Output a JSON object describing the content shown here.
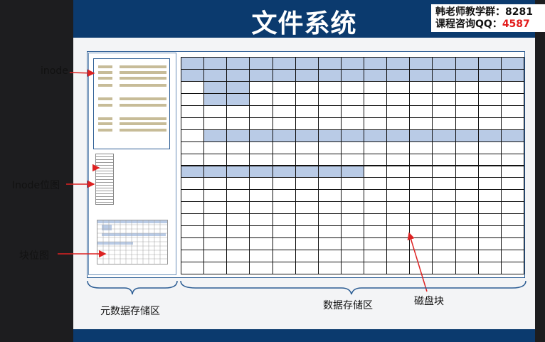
{
  "title": "文件系统",
  "corner": {
    "group_label": "韩老师教学群：",
    "group_value": "8281",
    "qq_label": "课程咨询QQ：",
    "qq_value": "4587"
  },
  "labels": {
    "inode": "inode",
    "inode_bitmap": "Inode位图",
    "block_bitmap": "块位图",
    "metadata_area": "元数据存储区",
    "data_area": "数据存储区",
    "disk_block": "磁盘块"
  },
  "grid": {
    "cols": 15,
    "rows": 18,
    "used_rows": [
      {
        "row": 0,
        "from": 0,
        "to": 14
      },
      {
        "row": 1,
        "from": 0,
        "to": 14
      },
      {
        "row": 2,
        "from": 1,
        "to": 2
      },
      {
        "row": 3,
        "from": 1,
        "to": 2
      },
      {
        "row": 6,
        "from": 1,
        "to": 14
      },
      {
        "row": 9,
        "from": 0,
        "to": 7
      }
    ]
  },
  "colors": {
    "header": "#0b3a6e",
    "used_block": "#b9cbe6",
    "inode_stripe": "#c7bc98",
    "arrow": "#dd2222"
  }
}
